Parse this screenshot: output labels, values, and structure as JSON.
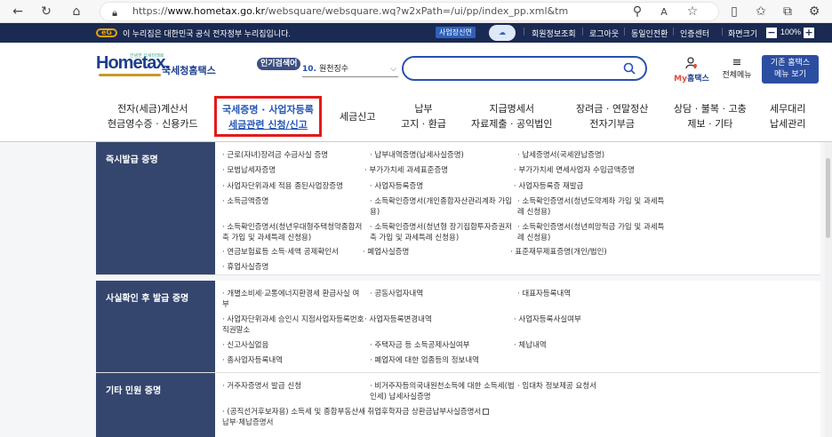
{
  "browser": {
    "url_prefix": "https://",
    "url_domain": "www.hometax.go.kr",
    "url_path": "/websquare/websquare.wq?w2xPath=/ui/pp/index_pp.xml&tmIdx=&tm2lIdx=&tm3..."
  },
  "topbar": {
    "logo": "eG",
    "notice": "이 누리집은 대한민국 공식 전자정부 누리집입니다.",
    "service_button": "사업장신연",
    "cloud_badge": "",
    "links": [
      "회원정보조회",
      "로그아웃",
      "동일인전환",
      "인증센터",
      "화면크기"
    ],
    "zoom_minus": "−",
    "zoom_value": "100%",
    "zoom_plus": "+"
  },
  "header": {
    "logo_main": "Hometax.",
    "logo_tagline": "안녕한 납세미래로",
    "logo_sub": "국세청홈택스",
    "popular_badge": "인기검색어",
    "popular_rank": "10.",
    "popular_term": "원천징수",
    "search_placeholder": "",
    "my_hometax_prefix": "My",
    "my_hometax_suffix": "홈택스",
    "all_menu": "전체메뉴",
    "legacy_button_line1": "기존 홈택스",
    "legacy_button_line2": "메뉴 보기"
  },
  "gnb": [
    {
      "line1": "전자(세금)계산서",
      "line2": "현금영수증 · 신용카드"
    },
    {
      "line1": "국세증명 · 사업자등록",
      "line2": "세금관련 신청/신고"
    },
    {
      "line1": "세금신고",
      "line2": ""
    },
    {
      "line1": "납부",
      "line2": "고지 · 환급"
    },
    {
      "line1": "지급명세서",
      "line2": "자료제출 · 공익법인"
    },
    {
      "line1": "장려금 · 연말정산",
      "line2": "전자기부금"
    },
    {
      "line1": "상담 · 불복 · 고충",
      "line2": "제보 · 기타"
    },
    {
      "line1": "세무대리",
      "line2": "납세관리"
    }
  ],
  "sections": [
    {
      "title": "즉시발급 증명",
      "items": [
        "· 근로(자녀)장려금 수급사실 증명",
        "· 납부내역증명(납세사실증명)",
        "· 납세증명서(국세완납증명)",
        "· 모범납세자증명",
        "· 부가가치세 과세표준증명",
        "· 부가가치세 면세사업자 수입금액증명",
        "· 사업자단위과세 적용 종된사업장증명",
        "· 사업자등록증명",
        "· 사업자등록증 재발급",
        "· 소득금액증명",
        "· 소득확인증명서(개인종합자산관리계좌 가입용)",
        "· 소득확인증명서(청년도약계좌 가입 및 과세특례 신청용)",
        "· 소득확인증명서(청년우대형주택청약종합저축 가입 및 과세특례 신청용)",
        "· 소득확인증명서(청년형 장기집합투자증권저축 가입 및 과세특례 신청용)",
        "· 소득확인증명서(청년희망적금 가입 및 과세특례 신청용)",
        "· 연금보험료등 소득·세액 공제확인서",
        "· 폐업사실증명",
        "· 표준재무제표증명(개인/법인)",
        "· 휴업사실증명"
      ]
    },
    {
      "title": "사실확인 후 발급 증명",
      "items": [
        "· 개별소비세·교통에너지환경세 환급사실 여부",
        "· 공동사업자내역",
        "· 대표자등록내역",
        "· 사업자단위과세 승인시 지점사업자등록번호 직권말소",
        "· 사업자등록변경내역",
        "· 사업자등록사실여부",
        "· 신고사실없음",
        "· 주택자금 등 소득공제사실여부",
        "· 체납내역",
        "· 총사업자등록내역",
        "· 폐업자에 대한 업종등의 정보내역"
      ]
    },
    {
      "title": "기타 민원 증명",
      "items": [
        "· 거주자증명서 발급 신청",
        "· 비거주자등의국내원천소득에 대한 소득세(법인세) 납세사실증명",
        "· 임대차 정보제공 요청서",
        "· (공직선거후보자용) 소득세 및 종합부동산세 납부·체납증명서",
        "· 취업후학자금 상환금납부사실증명서"
      ]
    }
  ]
}
